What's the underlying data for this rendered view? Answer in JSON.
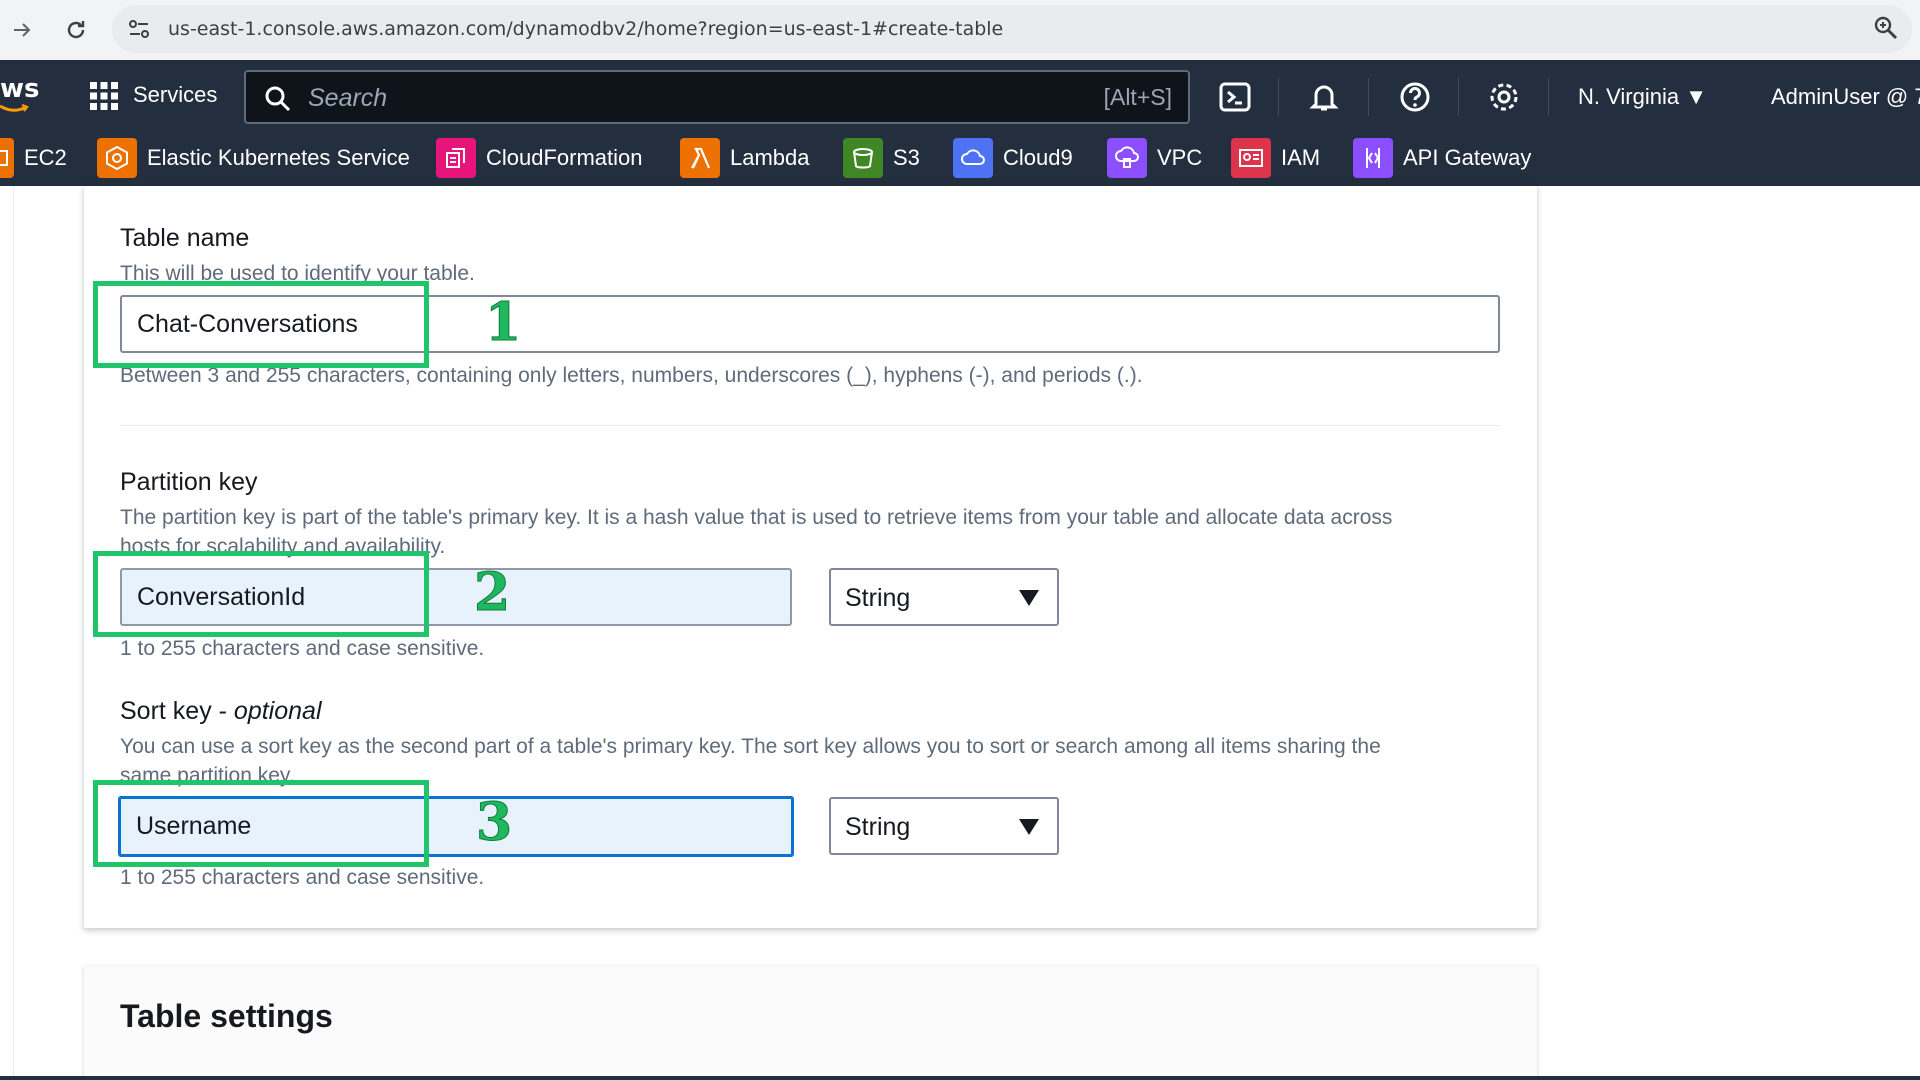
{
  "browser": {
    "url": "us-east-1.console.aws.amazon.com/dynamodbv2/home?region=us-east-1#create-table"
  },
  "aws_nav": {
    "logo_text": "ws",
    "services_label": "Services",
    "search_placeholder": "Search",
    "search_shortcut": "[Alt+S]",
    "region": "N. Virginia ▼",
    "account": "AdminUser @ 7"
  },
  "favorites": [
    {
      "label": "EC2",
      "color": "#ed7100"
    },
    {
      "label": "Elastic Kubernetes Service",
      "color": "#ed7100"
    },
    {
      "label": "CloudFormation",
      "color": "#e7157b"
    },
    {
      "label": "Lambda",
      "color": "#ed7100"
    },
    {
      "label": "S3",
      "color": "#3f8624"
    },
    {
      "label": "Cloud9",
      "color": "#4d72f3"
    },
    {
      "label": "VPC",
      "color": "#8c4fff"
    },
    {
      "label": "IAM",
      "color": "#dd344c"
    },
    {
      "label": "API Gateway",
      "color": "#8c4fff"
    }
  ],
  "form": {
    "table_name": {
      "label": "Table name",
      "description": "This will be used to identify your table.",
      "value": "Chat-Conversations",
      "hint": "Between 3 and 255 characters, containing only letters, numbers, underscores (_), hyphens (-), and periods (.)."
    },
    "partition_key": {
      "label": "Partition key",
      "description_line1": "The partition key is part of the table's primary key. It is a hash value that is used to retrieve items from your table and allocate data across",
      "description_line2": "hosts for scalability and availability.",
      "value": "ConversationId",
      "type": "String",
      "hint": "1 to 255 characters and case sensitive."
    },
    "sort_key": {
      "label": "Sort key - ",
      "label_optional": "optional",
      "description_line1": "You can use a sort key as the second part of a table's primary key. The sort key allows you to sort or search among all items sharing the",
      "description_line2": "same partition key.",
      "value": "Username",
      "type": "String",
      "hint": "1 to 255 characters and case sensitive."
    }
  },
  "annotations": [
    "1",
    "2",
    "3"
  ],
  "table_settings_title": "Table settings",
  "colors": {
    "aws_nav_bg": "#232f3e",
    "annotation_green": "#1fc46b",
    "focus_blue": "#0972d3"
  }
}
